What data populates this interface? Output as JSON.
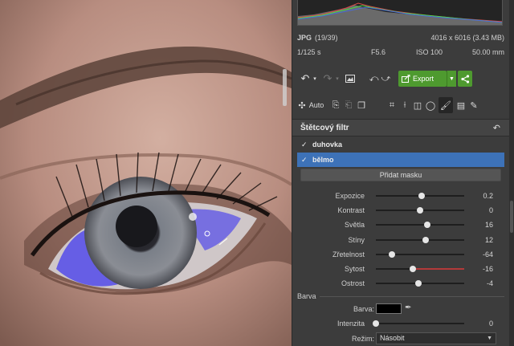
{
  "photo_info": {
    "format": "JPG",
    "index": "(19/39)",
    "resolution": "4016 x 6016 (3.43 MB)",
    "shutter": "1/125 s",
    "aperture": "F5.6",
    "iso": "ISO 100",
    "focal": "50.00 mm"
  },
  "toolbar": {
    "export_label": "Export",
    "auto_label": "Auto"
  },
  "filter": {
    "title": "Štětcový filtr",
    "masks": [
      {
        "label": "duhovka",
        "checked": true,
        "selected": false
      },
      {
        "label": "bělmo",
        "checked": true,
        "selected": true
      }
    ],
    "add_mask_label": "Přidat masku",
    "sliders": [
      {
        "label": "Expozice",
        "value": "0.2",
        "pos": 0.52
      },
      {
        "label": "Kontrast",
        "value": "0",
        "pos": 0.5
      },
      {
        "label": "Světla",
        "value": "16",
        "pos": 0.58
      },
      {
        "label": "Stíny",
        "value": "12",
        "pos": 0.56
      },
      {
        "label": "Zřetelnost",
        "value": "-64",
        "pos": 0.18
      },
      {
        "label": "Sytost",
        "value": "-16",
        "pos": 0.42
      },
      {
        "label": "Ostrost",
        "value": "-4",
        "pos": 0.48
      }
    ],
    "color_section": "Barva",
    "color_label": "Barva:",
    "color_value": "#000000",
    "intensity_label": "Intenzita",
    "intensity_value": "0",
    "intensity_pos": 0.0,
    "mode_label": "Režim:",
    "mode_value": "Násobit"
  },
  "colors": {
    "accent_green": "#4e9a2f",
    "selection_blue": "#3d72b8",
    "mask_overlay": "#5a52e8"
  },
  "icons": [
    "undo-icon",
    "redo-icon",
    "image-icon",
    "rotate-icon",
    "export-icon",
    "share-icon",
    "auto-icon",
    "copy-icon",
    "paste-icon",
    "crop-icon",
    "perspective-icon",
    "gradient-icon",
    "radial-icon",
    "brush-icon",
    "erase-icon",
    "reset-icon",
    "eyedropper-icon"
  ]
}
